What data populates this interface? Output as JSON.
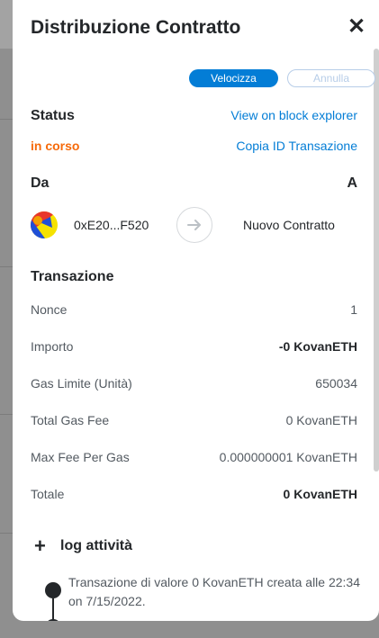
{
  "modal": {
    "title": "Distribuzione Contratto",
    "close_icon": "close-icon"
  },
  "actions": {
    "speed_up_label": "Velocizza",
    "cancel_label": "Annulla"
  },
  "status": {
    "label": "Status",
    "value": "in corso",
    "value_color": "#f66a0a",
    "block_explorer_link": "View on block explorer",
    "copy_tx_id_link": "Copia ID Transazione"
  },
  "from_to": {
    "from_label": "Da",
    "to_label": "A",
    "from_address": "0xE20...F520",
    "arrow_icon": "arrow-right-icon",
    "to_value": "Nuovo Contratto"
  },
  "transaction": {
    "heading": "Transazione",
    "rows": [
      {
        "label": "Nonce",
        "value": "1",
        "bold": false
      },
      {
        "label": "Importo",
        "value": "-0 KovanETH",
        "bold": true
      },
      {
        "label": "Gas Limite (Unità)",
        "value": "650034",
        "bold": false
      },
      {
        "label": "Total Gas Fee",
        "value": "0 KovanETH",
        "bold": false
      },
      {
        "label": "Max Fee Per Gas",
        "value": "0.000000001 KovanETH",
        "bold": false
      },
      {
        "label": "Totale",
        "value": "0 KovanETH",
        "bold": true
      }
    ]
  },
  "activity_log": {
    "toggle_icon": "plus-icon",
    "title": "log attività",
    "entries": [
      {
        "text": "Transazione di valore 0 KovanETH creata alle 22:34 on 7/15/2022."
      }
    ]
  },
  "colors": {
    "primary": "#037dd6",
    "text": "#24272a",
    "muted": "#535a61"
  }
}
